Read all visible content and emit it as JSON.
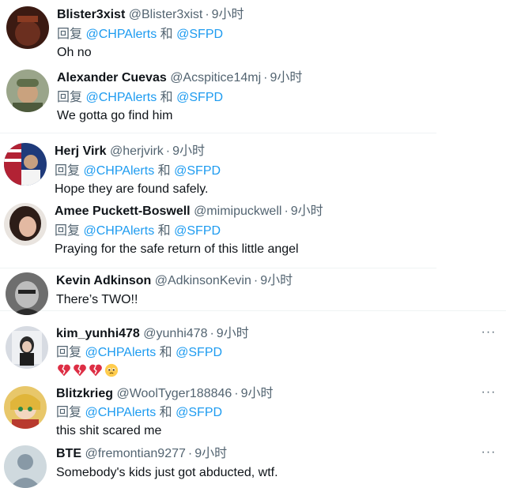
{
  "reply_prefix": "回复",
  "reply_and": "和",
  "tweets": [
    {
      "name": "Blister3xist",
      "handle": "@Blister3xist",
      "time": "9小时",
      "mention1": "@CHPAlerts",
      "mention2": "@SFPD",
      "text": "Oh no",
      "avatar_color": "#5a2a1e"
    },
    {
      "name": "Alexander Cuevas",
      "handle": "@Acspitice14mj",
      "time": "9小时",
      "mention1": "@CHPAlerts",
      "mention2": "@SFPD",
      "text": "We gotta go find him",
      "avatar_color": "#7c8b6a"
    },
    {
      "name": "Herj Virk",
      "handle": "@herjvirk",
      "time": "9小时",
      "mention1": "@CHPAlerts",
      "mention2": "@SFPD",
      "text": "Hope they are found safely.",
      "avatar_color": "#2f4f8f"
    },
    {
      "name": "Amee Puckett-Boswell",
      "handle": "@mimipuckwell",
      "time": "9小时",
      "mention1": "@CHPAlerts",
      "mention2": "@SFPD",
      "text": "Praying for the safe return of this little angel",
      "avatar_color": "#3a2a26"
    },
    {
      "name": "Kevin Adkinson",
      "handle": "@AdkinsonKevin",
      "time": "9小时",
      "text": "There’s TWO!!",
      "avatar_color": "#4a4a4a"
    },
    {
      "name": "kim_yunhi478",
      "handle": "@yunhi478",
      "time": "9小时",
      "mention1": "@CHPAlerts",
      "mention2": "@SFPD",
      "text": "",
      "emojis": [
        "broken-heart-icon",
        "broken-heart-icon",
        "broken-heart-icon",
        "pleading-face-icon"
      ],
      "avatar_color": "#cfd3da"
    },
    {
      "name": "Blitzkrieg",
      "handle": "@WoolTyger188846",
      "time": "9小时",
      "mention1": "@CHPAlerts",
      "mention2": "@SFPD",
      "text": "this shit scared me",
      "avatar_color": "#c94a3a"
    },
    {
      "name": "BTE",
      "handle": "@fremontian9277",
      "time": "9小时",
      "text": "Somebody's kids just got abducted, wtf.",
      "avatar_color": "#c3ccd4"
    }
  ],
  "more_label": "···"
}
